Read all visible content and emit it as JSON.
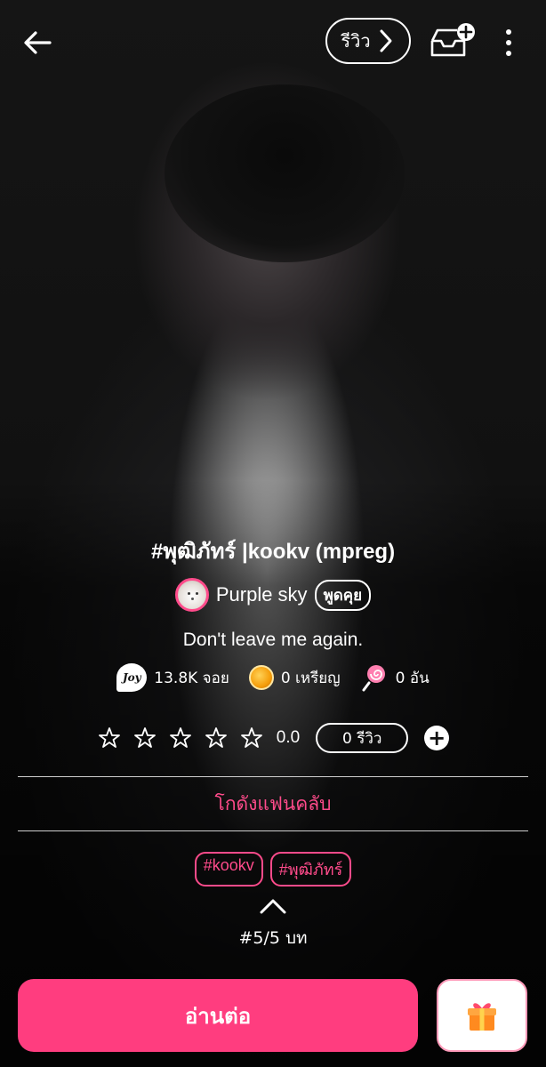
{
  "header": {
    "review_label": "รีวิว"
  },
  "story": {
    "title": "#พุฒิภัทร์ |kookv (mpreg)",
    "author": "Purple sky",
    "talk_label": "พูดคุย",
    "description": "Don't leave me again."
  },
  "stats": {
    "joy": "13.8K จอย",
    "coins": "0 เหรียญ",
    "candy": "0 อัน"
  },
  "rating": {
    "stars_filled": 0,
    "stars_total": 5,
    "value": "0.0",
    "review_count": "0 รีวิว"
  },
  "fanclub_label": "โกดังแฟนคลับ",
  "tags": [
    "#kookv",
    "#พุฒิภัทร์"
  ],
  "chapter": "#5/5 บท",
  "actions": {
    "read_label": "อ่านต่อ"
  },
  "colors": {
    "accent": "#ff3d7f",
    "accent_text": "#ff4b8b",
    "background": "#0d0d0d"
  }
}
